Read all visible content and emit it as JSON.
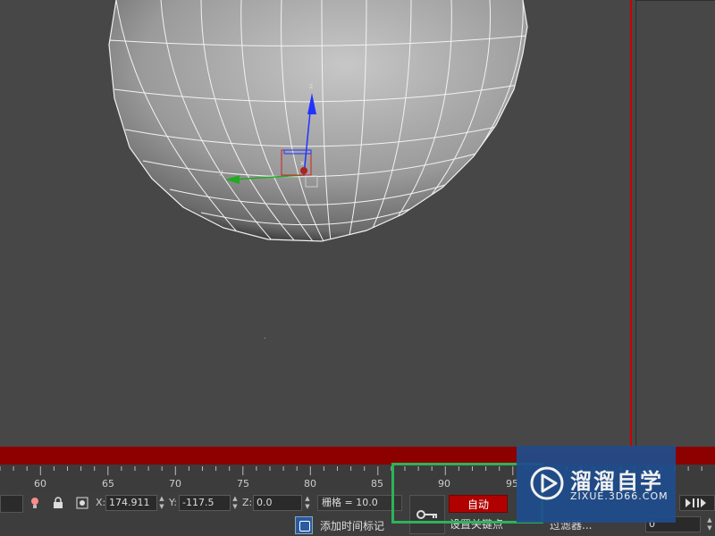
{
  "viewport": {
    "gizmo_axes": {
      "z": "z",
      "x": "x",
      "y": "y"
    },
    "colors": {
      "axis_z": "#2233ff",
      "axis_x": "#cc2222",
      "axis_y": "#22aa22",
      "border": "#cc0000"
    }
  },
  "timeline": {
    "ticks": [
      "60",
      "65",
      "70",
      "75",
      "80",
      "85",
      "90",
      "95"
    ]
  },
  "status": {
    "x_label": "X:",
    "x_value": "174.911",
    "y_label": "Y:",
    "y_value": "-117.5",
    "z_label": "Z:",
    "z_value": "0.0",
    "grid": "栅格 = 10.0",
    "add_time_tag": "添加时间标记"
  },
  "animation": {
    "auto_label": "自动",
    "set_key_label": "设置关键点",
    "filter_label": "过滤器...",
    "frame_value": "0"
  },
  "watermark": {
    "title": "溜溜自学",
    "subtitle": "ZIXUE.3D66.COM"
  },
  "icons": [
    "bulb-icon",
    "lock-icon",
    "transform-mode-icon",
    "key-icon",
    "play-icon",
    "next-frame-icon"
  ]
}
